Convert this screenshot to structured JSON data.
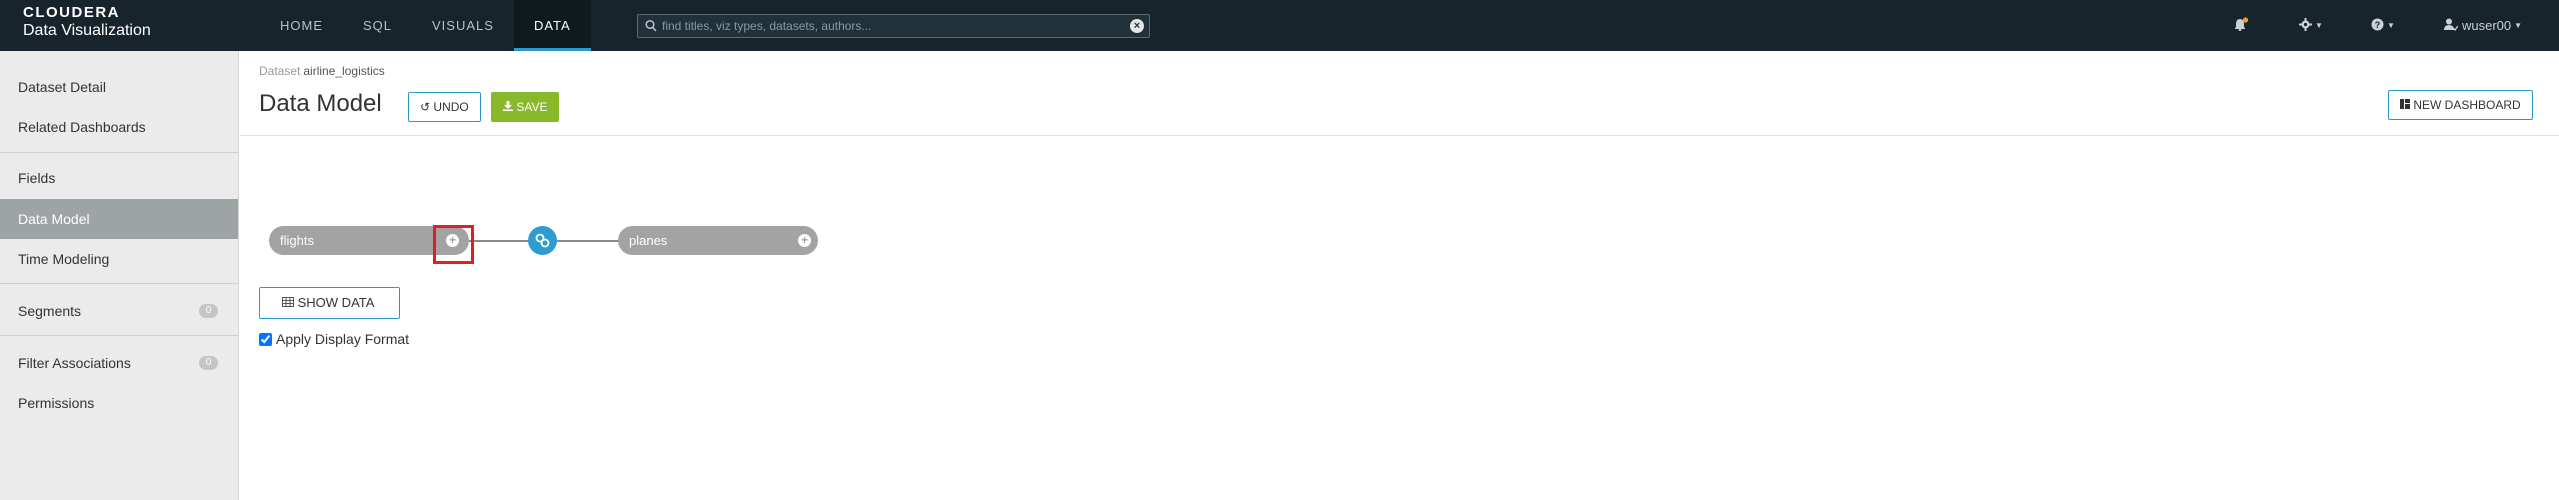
{
  "brand": {
    "line1": "CLOUDERA",
    "line2": "Data Visualization"
  },
  "nav": {
    "tabs": [
      "HOME",
      "SQL",
      "VISUALS",
      "DATA"
    ],
    "active": "DATA"
  },
  "search": {
    "placeholder": "find titles, viz types, datasets, authors..."
  },
  "header": {
    "user": "wuser00"
  },
  "sidebar": {
    "items": [
      {
        "label": "Dataset Detail"
      },
      {
        "label": "Related Dashboards"
      },
      {
        "label": "Fields"
      },
      {
        "label": "Data Model",
        "active": true
      },
      {
        "label": "Time Modeling"
      },
      {
        "label": "Segments",
        "count": "0"
      },
      {
        "label": "Filter Associations",
        "count": "0"
      },
      {
        "label": "Permissions"
      }
    ]
  },
  "main": {
    "breadcrumb_label": "Dataset",
    "breadcrumb_value": "airline_logistics",
    "title": "Data Model",
    "undo_label": "UNDO",
    "save_label": "SAVE",
    "new_dashboard_label": "NEW DASHBOARD",
    "show_data_label": "SHOW DATA",
    "apply_display_format_label": "Apply Display Format",
    "apply_display_format_checked": true
  },
  "model": {
    "left_table": "flights",
    "right_table": "planes"
  },
  "colors": {
    "accent": "#2e98c8",
    "save": "#89b92a",
    "topbar": "#17242b",
    "highlight": "#e02020"
  }
}
